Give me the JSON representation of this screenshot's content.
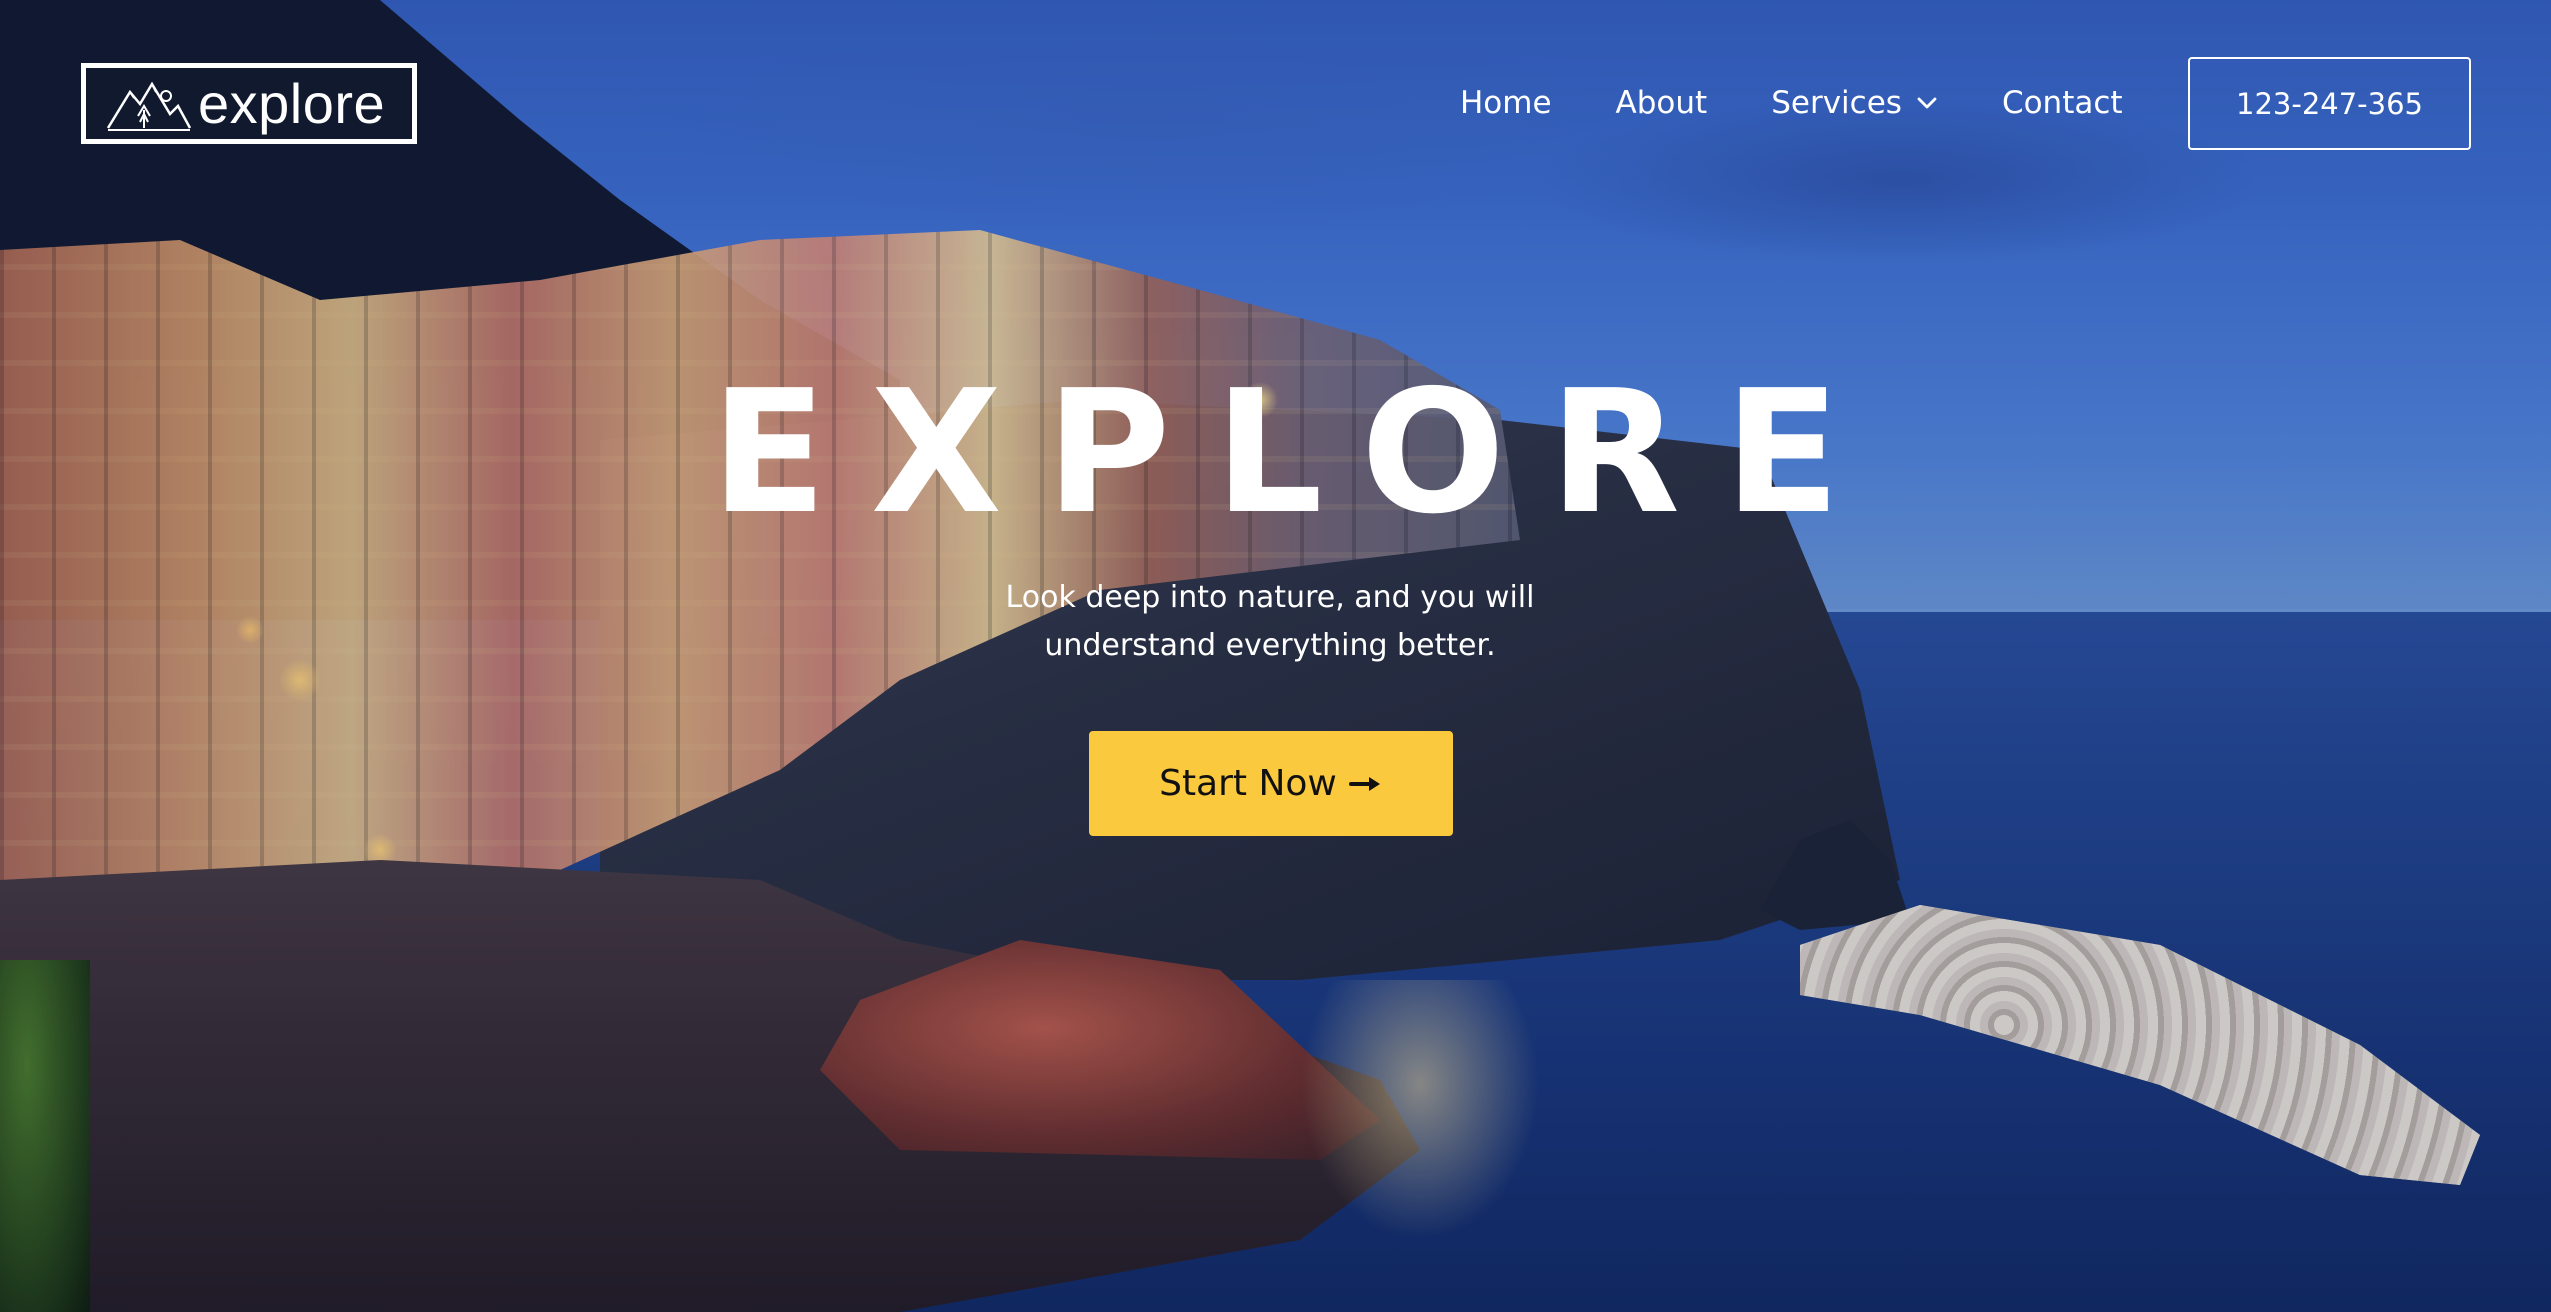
{
  "brand": {
    "logo_text": "explore",
    "logo_icon": "mountain-tree-icon"
  },
  "nav": {
    "items": [
      {
        "label": "Home"
      },
      {
        "label": "About"
      },
      {
        "label": "Services",
        "has_dropdown": true,
        "icon": "chevron-down-icon"
      },
      {
        "label": "Contact"
      }
    ],
    "phone": "123-247-365"
  },
  "hero": {
    "title": "EXPLORE",
    "subtitle_line1": "Look deep into nature, and you will",
    "subtitle_line2": "understand everything better.",
    "cta_label": "Start Now",
    "cta_icon": "arrow-right-icon"
  },
  "colors": {
    "accent": "#fbc93d",
    "text": "#ffffff",
    "sky": "#3e6fd0",
    "sea": "#1c3b80"
  }
}
